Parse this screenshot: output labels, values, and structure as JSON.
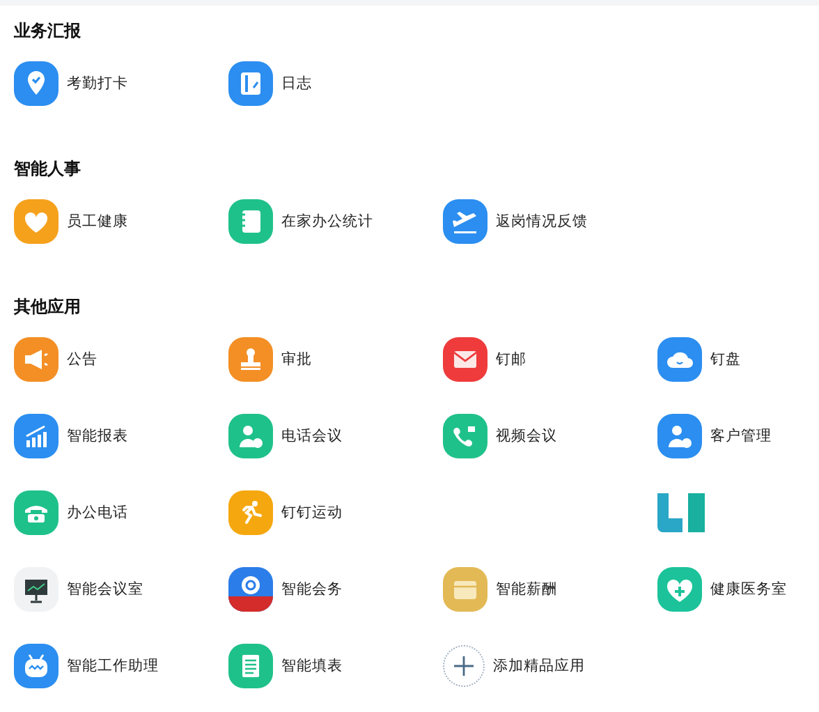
{
  "sections": [
    {
      "title": "业务汇报",
      "items": [
        {
          "kind": "app",
          "label": "考勤打卡",
          "color": "#2b8ef0"
        },
        {
          "kind": "app",
          "label": "日志",
          "color": "#2b8ef0"
        }
      ]
    },
    {
      "title": "智能人事",
      "items": [
        {
          "kind": "app",
          "label": "员工健康",
          "color": "#f5a11c"
        },
        {
          "kind": "app",
          "label": "在家办公统计",
          "color": "#1fc18a"
        },
        {
          "kind": "app",
          "label": "返岗情况反馈",
          "color": "#2b8ef0"
        }
      ]
    },
    {
      "title": "其他应用",
      "items": [
        {
          "kind": "app",
          "label": "公告",
          "color": "#f38f25"
        },
        {
          "kind": "app",
          "label": "审批",
          "color": "#f38f25"
        },
        {
          "kind": "app",
          "label": "钉邮",
          "color": "#ef3b3b"
        },
        {
          "kind": "app",
          "label": "钉盘",
          "color": "#2b8ef0"
        },
        {
          "kind": "app",
          "label": "智能报表",
          "color": "#2b8ef0"
        },
        {
          "kind": "app",
          "label": "电话会议",
          "color": "#1fc18a"
        },
        {
          "kind": "app",
          "label": "视频会议",
          "color": "#1fc18a"
        },
        {
          "kind": "app",
          "label": "客户管理",
          "color": "#2b8ef0"
        },
        {
          "kind": "app",
          "label": "办公电话",
          "color": "#1fc18a"
        },
        {
          "kind": "app",
          "label": "钉钉运动",
          "color": "#f5a70f"
        },
        {
          "kind": "empty"
        },
        {
          "kind": "logo"
        },
        {
          "kind": "app",
          "label": "智能会议室",
          "color": "#f1f2f4"
        },
        {
          "kind": "app",
          "label": "智能会务",
          "color": "#2b7de9"
        },
        {
          "kind": "app",
          "label": "智能薪酬",
          "color": "#e3b955"
        },
        {
          "kind": "app",
          "label": "健康医务室",
          "color": "#1cc39a"
        },
        {
          "kind": "app",
          "label": "智能工作助理",
          "color": "#2b8ef0"
        },
        {
          "kind": "app",
          "label": "智能填表",
          "color": "#1fc18a"
        },
        {
          "kind": "add",
          "label": "添加精品应用"
        }
      ]
    }
  ]
}
